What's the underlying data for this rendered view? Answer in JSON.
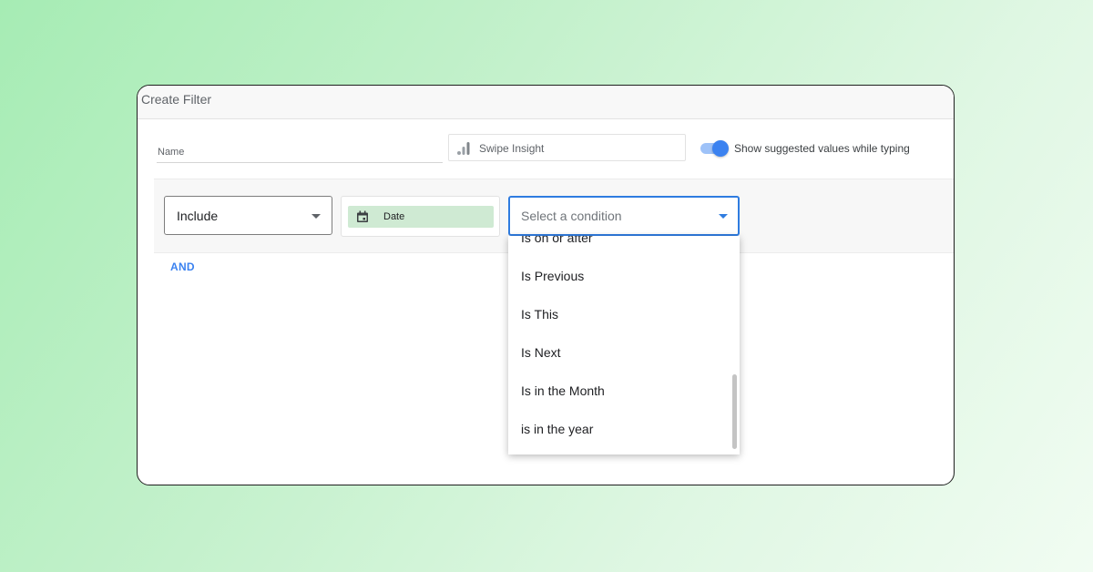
{
  "dialog": {
    "title": "Create Filter"
  },
  "name_field": {
    "label": "Name"
  },
  "data_source": {
    "label": "Swipe Insight",
    "icon": "analytics-bars-icon"
  },
  "suggest_toggle": {
    "label": "Show suggested values while typing",
    "on": true
  },
  "clause": {
    "mode": "Include",
    "field": "Date",
    "field_icon": "calendar-icon",
    "condition_placeholder": "Select a condition"
  },
  "and_label": "AND",
  "condition_options": [
    "Is on or after",
    "Is Previous",
    "Is This",
    "Is Next",
    "Is in the Month",
    "is in the year"
  ],
  "colors": {
    "accent": "#3b82f0",
    "chip": "#cfead3"
  }
}
